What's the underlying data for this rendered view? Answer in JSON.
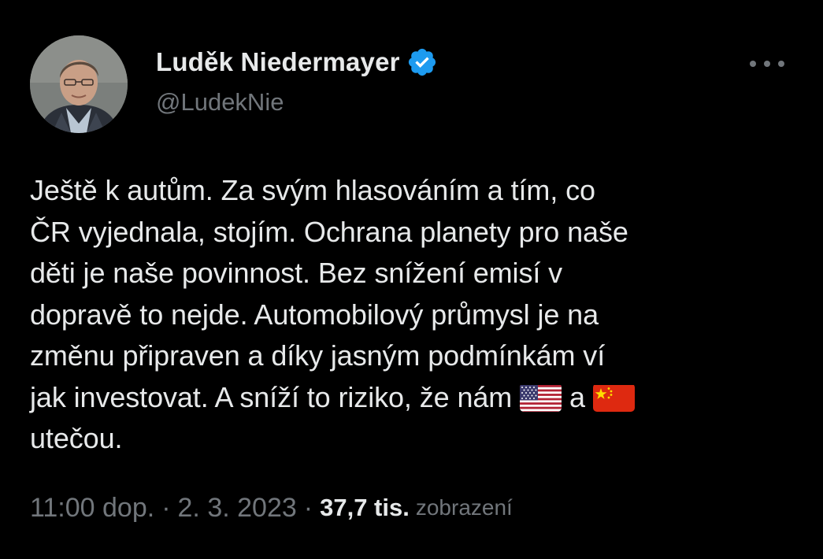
{
  "author": {
    "display_name": "Luděk Niedermayer",
    "handle": "@LudekNie",
    "verified": true
  },
  "tweet": {
    "lines": [
      "Ještě k autům. Za svým hlasováním a tím, co",
      "ČR vyjednala, stojím. Ochrana planety pro naše",
      "děti je naše povinnost. Bez snížení emisí v",
      "dopravě to nejde. Automobilový průmysl je na",
      "změnu připraven a díky jasným podmínkám ví",
      "jak investovat. A sníží to riziko, že nám",
      "a",
      "utečou."
    ],
    "emoji": [
      "us-flag",
      "china-flag"
    ]
  },
  "meta": {
    "time": "11:00 dop.",
    "separator": "·",
    "date": "2. 3. 2023",
    "views_count": "37,7 tis.",
    "views_label": "zobrazení"
  },
  "colors": {
    "background": "#000000",
    "text_primary": "#e7e9ea",
    "text_secondary": "#71767b",
    "verified_badge": "#1d9bf0"
  },
  "icons": {
    "verified": "verified-badge-icon",
    "more": "more-options-icon"
  }
}
